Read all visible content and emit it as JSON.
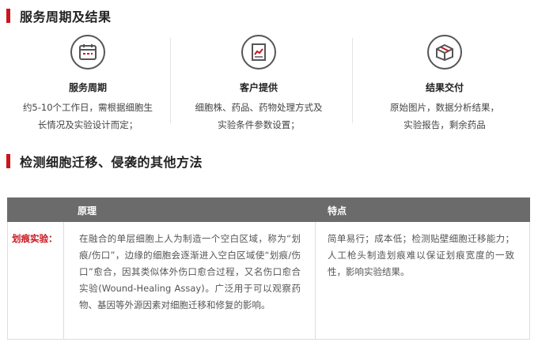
{
  "section1": {
    "title": "服务周期及结果"
  },
  "features": [
    {
      "icon": "calendar-icon",
      "title": "服务周期",
      "desc_line1": "约5-10个工作日，需根据细胞生",
      "desc_line2": "长情况及实验设计而定；"
    },
    {
      "icon": "document-chart-icon",
      "title": "客户提供",
      "desc_line1": "细胞株、药品、药物处理方式及",
      "desc_line2": "实验条件参数设置；"
    },
    {
      "icon": "package-icon",
      "title": "结果交付",
      "desc_line1": "原始图片，数据分析结果，",
      "desc_line2": "实验报告，剩余药品"
    }
  ],
  "section2": {
    "title": "检测细胞迁移、侵袭的其他方法"
  },
  "table": {
    "headers": [
      "原理",
      "特点"
    ],
    "rows": [
      {
        "label": "划痕实验：",
        "principle": "在融合的单层细胞上人为制造一个空白区域，称为“划痕/伤口”，边缘的细胞会逐渐进入空白区域使“划痕/伤口”愈合，因其类似体外伤口愈合过程，又名伤口愈合实验(Wound-Healing Assay)。广泛用于可以观察药物、基因等外源因素对细胞迁移和修复的影响。",
        "features": "简单易行；成本低；检测贴壁细胞迁移能力；人工枪头制造划痕难以保证划痕宽度的一致性，影响实验结果。"
      }
    ]
  },
  "colors": {
    "accent": "#c8161e",
    "header_bg": "#6b6b6b"
  }
}
